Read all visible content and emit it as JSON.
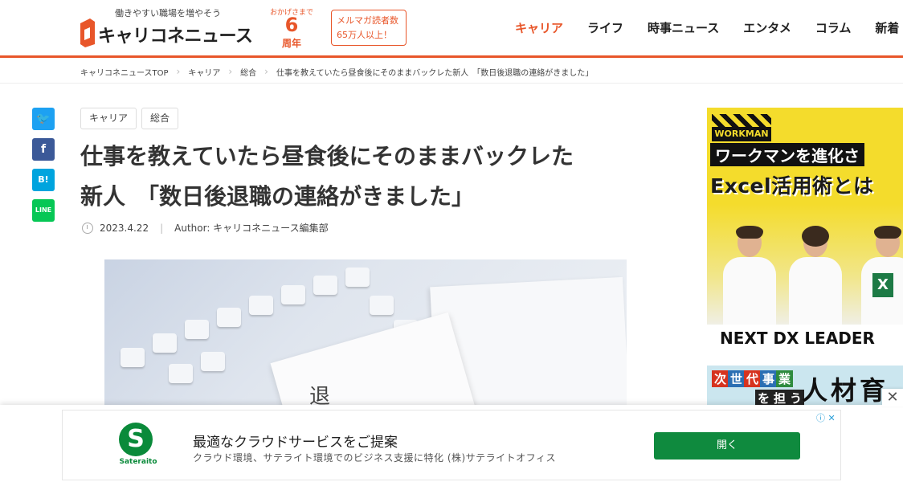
{
  "header": {
    "tagline": "働きやすい職場を増やそう",
    "logo_text": "キャリコネニュース",
    "anniversary": {
      "top": "おかげさまで",
      "number": "6",
      "bottom": "周年"
    },
    "newsletter": {
      "line1": "メルマガ読者数",
      "line2": "65万人以上！"
    },
    "nav": [
      {
        "label": "キャリア",
        "active": true
      },
      {
        "label": "ライフ",
        "active": false
      },
      {
        "label": "時事ニュース",
        "active": false
      },
      {
        "label": "エンタメ",
        "active": false
      },
      {
        "label": "コラム",
        "active": false
      },
      {
        "label": "新着",
        "active": false
      }
    ]
  },
  "breadcrumb": [
    "キャリコネニュースTOP",
    "キャリア",
    "総合",
    "仕事を教えていたら昼食後にそのままバックレた新人　「数日後退職の連絡がきました」"
  ],
  "share": {
    "twitter": "🐦",
    "facebook": "f",
    "hatena": "B!",
    "line": "LINE"
  },
  "article": {
    "tags": [
      "キャリア",
      "総合"
    ],
    "title_line1": "仕事を教えていたら昼食後にそのままバックレた",
    "title_line2": "新人　「数日後退職の連絡がきました」",
    "date": "2023.4.22",
    "author": "Author: キャリコネニュース編集部",
    "image_text": "退"
  },
  "side_ad": {
    "brand": "WORKMAN",
    "line1": "ワークマンを進化さ",
    "line2": "Excel活用術とは",
    "band": "NEXT DX LEADER",
    "excel_letter": "X",
    "ad2_words": [
      "次",
      "世",
      "代",
      "事",
      "業",
      "を",
      "担",
      "う"
    ],
    "ad2_big": "人材育"
  },
  "bottom_ad": {
    "brand": "Sateraito",
    "logo_letter": "S",
    "headline": "最適なクラウドサービスをご提案",
    "description": "クラウド環境、サテライト環境でのビジネス支援に特化 (株)サテライトオフィス",
    "button": "開く",
    "adchoices": "ⓘ ✕",
    "close": "✕"
  },
  "colors": {
    "accent": "#e8562a",
    "ad_green": "#0f8a3e",
    "ad_yellow": "#f4dc2c"
  }
}
